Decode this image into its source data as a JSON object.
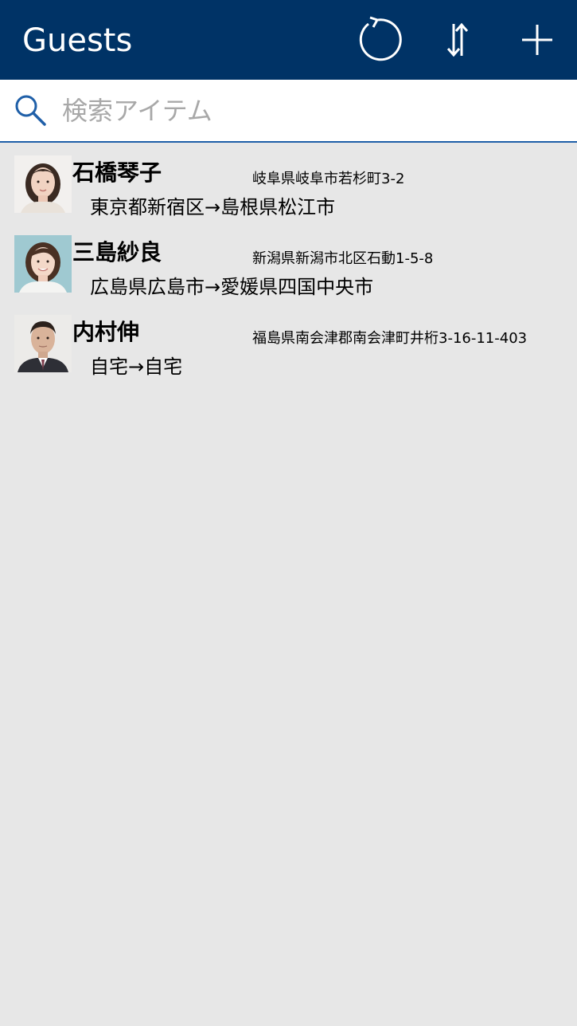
{
  "header": {
    "title": "Guests",
    "background": "#003366",
    "actions": [
      {
        "name": "refresh",
        "icon": "refresh-icon"
      },
      {
        "name": "sort",
        "icon": "sort-arrows-icon"
      },
      {
        "name": "add",
        "icon": "plus-icon"
      }
    ]
  },
  "search": {
    "placeholder": "検索アイテム",
    "value": "",
    "icon": "search-icon",
    "accent": "#1f5fa8"
  },
  "guests": [
    {
      "name": "石橋琴子",
      "address": "岐阜県岐阜市若杉町3-2",
      "route": "東京都新宿区→島根県松江市",
      "avatar": "female-portrait-photo"
    },
    {
      "name": "三島紗良",
      "address": "新潟県新潟市北区石動1-5-8",
      "route": "広島県広島市→愛媛県四国中央市",
      "avatar": "female-portrait-photo"
    },
    {
      "name": "内村伸",
      "address": "福島県南会津郡南会津町井桁3-16-11-403",
      "route": "自宅→自宅",
      "avatar": "male-portrait-photo"
    }
  ]
}
